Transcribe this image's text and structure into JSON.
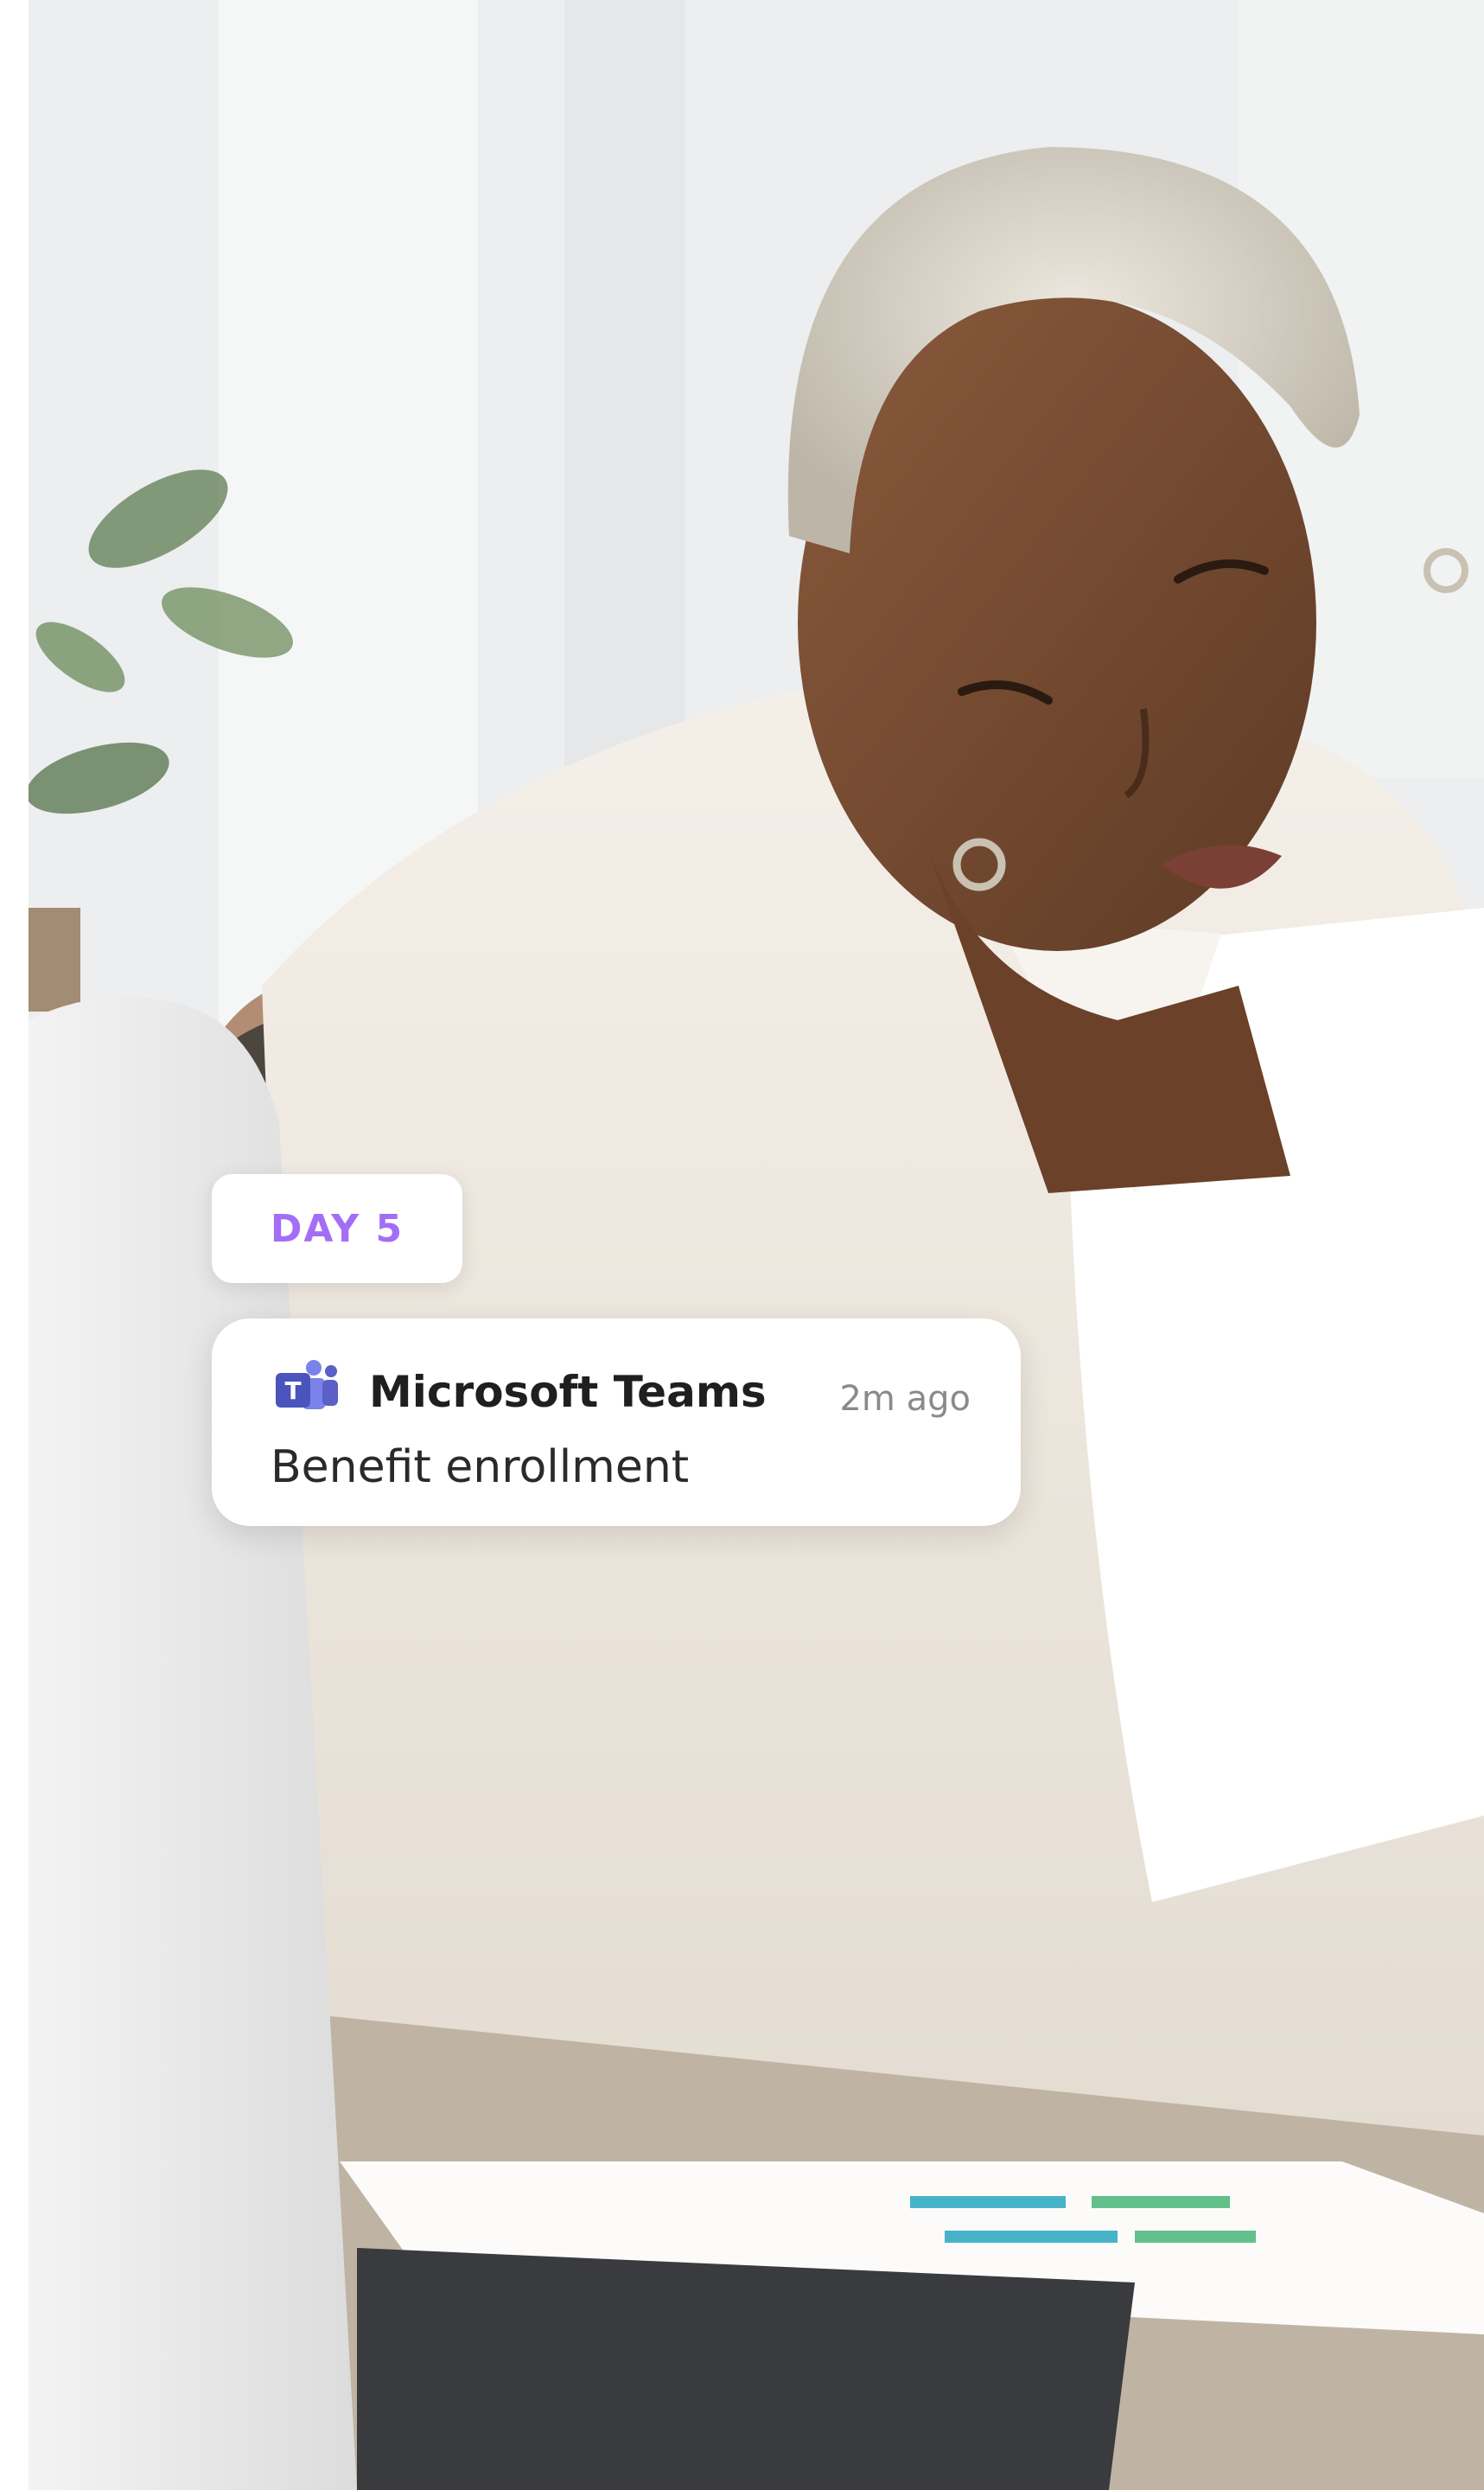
{
  "badge": {
    "label": "DAY 5",
    "color": "#a36ef5"
  },
  "notification": {
    "icon": "microsoft-teams-icon",
    "app_name": "Microsoft Teams",
    "time": "2m ago",
    "message": "Benefit enrollment",
    "brand_color": "#5b5fc7"
  }
}
